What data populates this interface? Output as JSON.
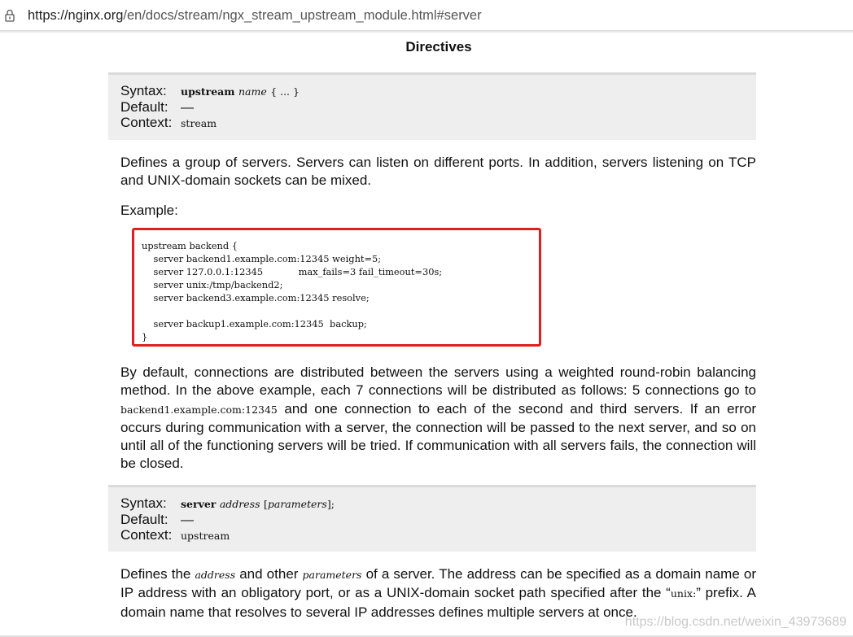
{
  "browser": {
    "url_host": "https://nginx.org",
    "url_path": "/en/docs/stream/ngx_stream_upstream_module.html#server",
    "lock_icon": "lock-icon"
  },
  "page": {
    "heading": "Directives",
    "watermark": "https://blog.csdn.net/weixin_43973689"
  },
  "directive1": {
    "syntax_label": "Syntax:",
    "syntax_kw": "upstream",
    "syntax_arg": "name",
    "syntax_rest": "{ ... }",
    "default_label": "Default:",
    "default_value": "—",
    "context_label": "Context:",
    "context_value": "stream"
  },
  "para1": "Defines a group of servers. Servers can listen on different ports. In addition, servers listening on TCP and UNIX-domain sockets can be mixed.",
  "example_label": "Example:",
  "code_example": "upstream backend {\n    server backend1.example.com:12345 weight=5;\n    server 127.0.0.1:12345            max_fails=3 fail_timeout=30s;\n    server unix:/tmp/backend2;\n    server backend3.example.com:12345 resolve;\n\n    server backup1.example.com:12345  backup;\n}",
  "para2": {
    "part1": "By default, connections are distributed between the servers using a weighted round-robin balancing method. In the above example, each 7 connections will be distributed as follows: 5 connections go to ",
    "code": "backend1.example.com:12345",
    "part2": " and one connection to each of the second and third servers. If an error occurs during communication with a server, the connection will be passed to the next server, and so on until all of the functioning servers will be tried. If communication with all servers fails, the connection will be closed."
  },
  "directive2": {
    "syntax_label": "Syntax:",
    "syntax_kw": "server",
    "syntax_arg": "address",
    "syntax_rest_open": "[",
    "syntax_params": "parameters",
    "syntax_rest_close": "];",
    "default_label": "Default:",
    "default_value": "—",
    "context_label": "Context:",
    "context_value": "upstream"
  },
  "para3": {
    "part1": "Defines the ",
    "code1": "address",
    "part2": " and other ",
    "code2": "parameters",
    "part3": " of a server. The address can be specified as a domain name or IP address with an obligatory port, or as a UNIX-domain socket path specified after the “",
    "code3": "unix:",
    "part4": "” prefix. A domain name that resolves to several IP addresses defines multiple servers at once."
  }
}
